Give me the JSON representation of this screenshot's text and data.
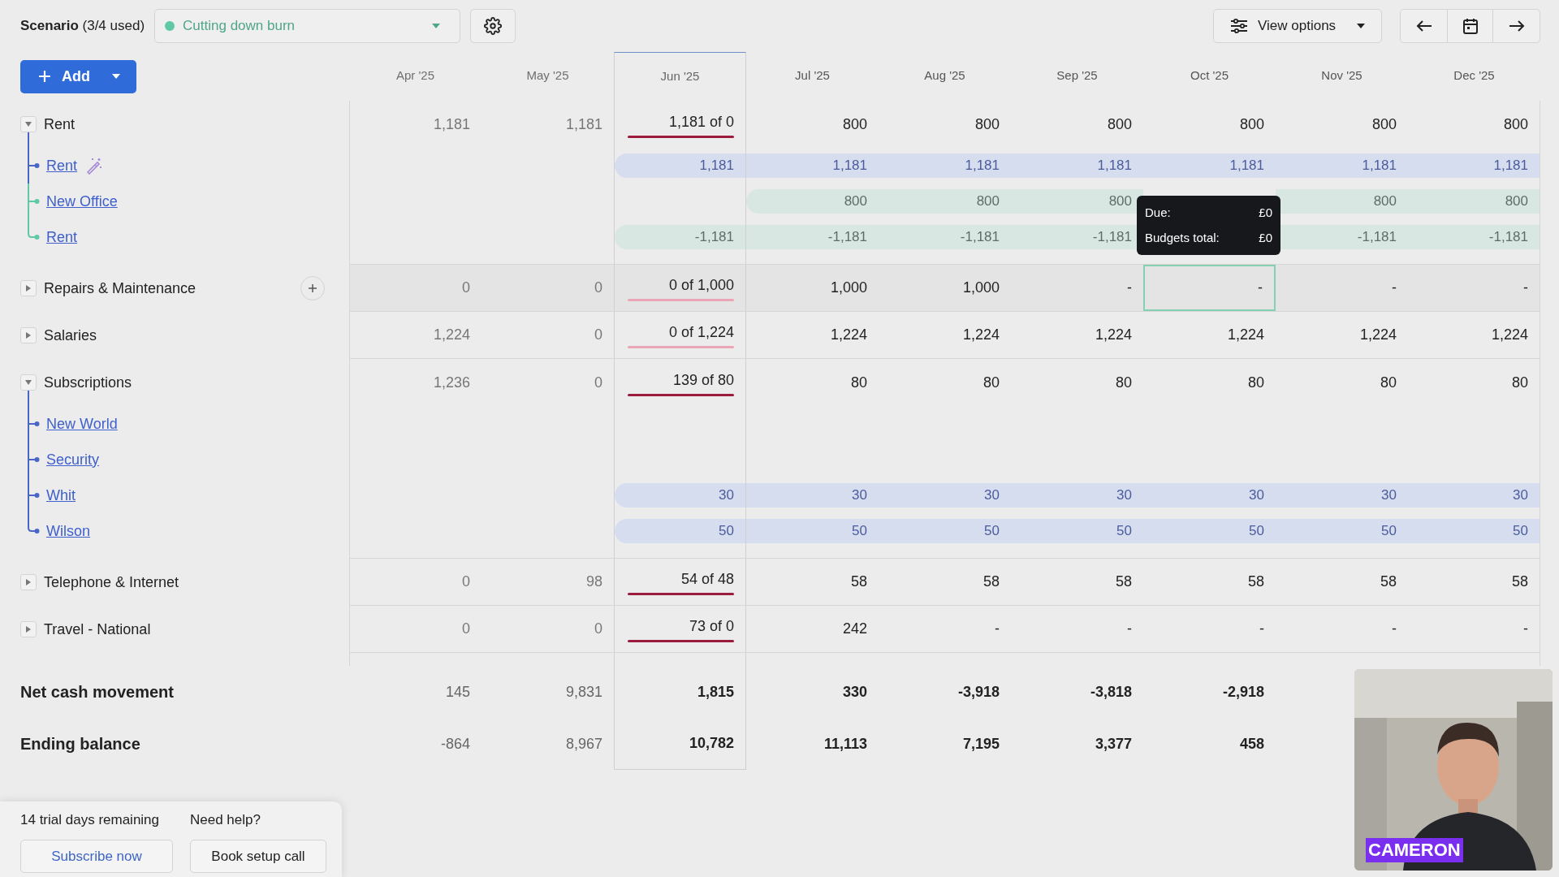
{
  "scenario": {
    "title": "**Scenario** (3/4 used)",
    "selected": "Cutting down burn",
    "color": "#5fc8a4"
  },
  "view_options": "View options",
  "add_button": "Add",
  "months": [
    {
      "label": "Apr '25",
      "past": true,
      "current": false
    },
    {
      "label": "May '25",
      "past": true,
      "current": false
    },
    {
      "label": "Jun '25",
      "past": false,
      "current": true
    },
    {
      "label": "Jul '25",
      "past": false,
      "current": false
    },
    {
      "label": "Aug '25",
      "past": false,
      "current": false
    },
    {
      "label": "Sep '25",
      "past": false,
      "current": false
    },
    {
      "label": "Oct '25",
      "past": false,
      "current": false
    },
    {
      "label": "Nov '25",
      "past": false,
      "current": false
    },
    {
      "label": "Dec '25",
      "past": false,
      "current": false
    }
  ],
  "groups": [
    {
      "label": "Rent",
      "expanded": true,
      "hovered": false,
      "add_button": false,
      "over_budget": true,
      "cells": [
        "1,181",
        "1,181",
        "1,181 of 0",
        "800",
        "800",
        "800",
        "800",
        "800",
        "800"
      ],
      "children": [
        {
          "label": "Rent",
          "kind": "actual",
          "color": "#4a66c4",
          "wand": true,
          "cells": [
            null,
            null,
            "1,181",
            "1,181",
            "1,181",
            "1,181",
            "1,181",
            "1,181",
            "1,181"
          ]
        },
        {
          "label": "New Office",
          "kind": "scenario",
          "color": "#5fc8a4",
          "wand": false,
          "cells": [
            null,
            null,
            null,
            "800",
            "800",
            "800",
            null,
            "800",
            "800"
          ]
        },
        {
          "label": "Rent",
          "kind": "scenario",
          "color": "#5fc8a4",
          "wand": false,
          "cells": [
            null,
            null,
            "-1,181",
            "-1,181",
            "-1,181",
            "-1,181",
            null,
            "-1,181",
            "-1,181"
          ]
        }
      ]
    },
    {
      "label": "Repairs & Maintenance",
      "expanded": false,
      "hovered": true,
      "add_button": true,
      "over_budget": false,
      "cells": [
        "0",
        "0",
        "0 of 1,000",
        "1,000",
        "1,000",
        "-",
        {
          "value": "-",
          "selected": true,
          "tooltip": [
            {
              "label": "Due:",
              "value": "£0"
            },
            {
              "label": "Budgets total:",
              "value": "£0"
            }
          ]
        },
        "-",
        "-"
      ]
    },
    {
      "label": "Salaries",
      "expanded": false,
      "hovered": false,
      "add_button": false,
      "over_budget": false,
      "cells": [
        "1,224",
        "0",
        "0 of 1,224",
        "1,224",
        "1,224",
        "1,224",
        "1,224",
        "1,224",
        "1,224"
      ]
    },
    {
      "label": "Subscriptions",
      "expanded": true,
      "hovered": false,
      "add_button": false,
      "over_budget": true,
      "cells": [
        "1,236",
        "0",
        "139 of 80",
        "80",
        "80",
        "80",
        "80",
        "80",
        "80"
      ],
      "children": [
        {
          "label": "New World",
          "color": "#4a66c4",
          "wand": false,
          "cells": [
            null,
            null,
            null,
            null,
            null,
            null,
            null,
            null,
            null
          ]
        },
        {
          "label": "Security",
          "color": "#4a66c4",
          "wand": false,
          "cells": [
            null,
            null,
            null,
            null,
            null,
            null,
            null,
            null,
            null
          ]
        },
        {
          "label": "Whit",
          "kind": "actual",
          "color": "#4a66c4",
          "wand": false,
          "cells": [
            null,
            null,
            "30",
            "30",
            "30",
            "30",
            "30",
            "30",
            "30"
          ]
        },
        {
          "label": "Wilson",
          "kind": "actual",
          "color": "#4a66c4",
          "wand": false,
          "cells": [
            null,
            null,
            "50",
            "50",
            "50",
            "50",
            "50",
            "50",
            "50"
          ]
        }
      ]
    },
    {
      "label": "Telephone & Internet",
      "expanded": false,
      "hovered": false,
      "add_button": false,
      "over_budget": true,
      "cells": [
        "0",
        "98",
        "54 of 48",
        "58",
        "58",
        "58",
        "58",
        "58",
        "58"
      ]
    },
    {
      "label": "Travel - National",
      "expanded": false,
      "hovered": false,
      "add_button": false,
      "over_budget": true,
      "cells": [
        "0",
        "0",
        "73 of 0",
        "242",
        "-",
        "-",
        "-",
        "-",
        "-"
      ]
    }
  ],
  "summary": [
    {
      "label": "Net cash movement",
      "cells": [
        "145",
        "9,831",
        "1,815",
        "330",
        "-3,918",
        "-3,818",
        "-2,918",
        null,
        null
      ]
    },
    {
      "label": "Ending balance",
      "cells": [
        "-864",
        "8,967",
        "10,782",
        "11,113",
        "7,195",
        "3,377",
        "458",
        null,
        null
      ]
    }
  ],
  "trial": {
    "days": "14 trial days remaining",
    "help": "Need help?",
    "subscribe": "Subscribe now",
    "book": "Book setup call"
  },
  "webcam": {
    "name": "CAMERON"
  }
}
